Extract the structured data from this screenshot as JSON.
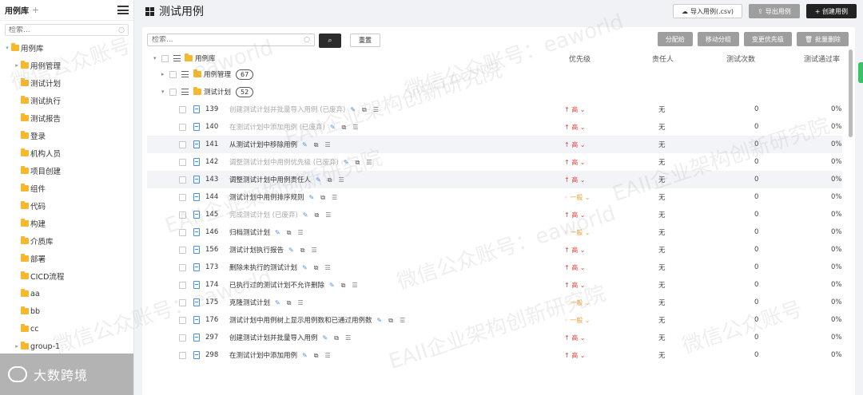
{
  "sidebar": {
    "title": "用例库",
    "plus": "+",
    "search_placeholder": "检索...",
    "items": [
      {
        "label": "用例库",
        "arrow": "▾"
      },
      {
        "label": "用例管理",
        "arrow": "▸"
      },
      {
        "label": "测试计划",
        "arrow": ""
      },
      {
        "label": "测试执行",
        "arrow": ""
      },
      {
        "label": "测试报告",
        "arrow": ""
      },
      {
        "label": "登录",
        "arrow": ""
      },
      {
        "label": "机构人员",
        "arrow": ""
      },
      {
        "label": "项目创建",
        "arrow": ""
      },
      {
        "label": "组件",
        "arrow": ""
      },
      {
        "label": "代码",
        "arrow": ""
      },
      {
        "label": "构建",
        "arrow": ""
      },
      {
        "label": "介质库",
        "arrow": ""
      },
      {
        "label": "部署",
        "arrow": ""
      },
      {
        "label": "CICD流程",
        "arrow": ""
      },
      {
        "label": "aa",
        "arrow": ""
      },
      {
        "label": "bb",
        "arrow": ""
      },
      {
        "label": "cc",
        "arrow": ""
      },
      {
        "label": "group-1",
        "arrow": "▸"
      }
    ],
    "footer_brand": "大数跨境"
  },
  "header": {
    "title": "测试用例",
    "import_label": "导入用例(.csv)",
    "export_label": "导出用例",
    "create_label": "+ 创建用例"
  },
  "toolbar": {
    "search_placeholder": "检索...",
    "reset_label": "重置",
    "assign_label": "分配给",
    "move_label": "移动分组",
    "priority_label": "变更优先级",
    "delete_label": "批量删除"
  },
  "table": {
    "columns": {
      "priority": "优先级",
      "owner": "责任人",
      "runs": "测试次数",
      "pass_rate": "测试通过率"
    },
    "root_label": "用例库",
    "groups": [
      {
        "label": "用例管理",
        "count": "67"
      },
      {
        "label": "测试计划",
        "count": "52"
      }
    ],
    "rows": [
      {
        "id": "139",
        "title": "创建测试计划并批量导入用例 (已废弃)",
        "priority": "高",
        "level": "high",
        "deprecated": true,
        "owner": "无",
        "runs": "0",
        "rate": "0%"
      },
      {
        "id": "140",
        "title": "在测试计划中添加用例 (已废弃)",
        "priority": "高",
        "level": "high",
        "deprecated": true,
        "owner": "无",
        "runs": "0",
        "rate": "0%"
      },
      {
        "id": "141",
        "title": "从测试计划中移除用例",
        "priority": "高",
        "level": "high",
        "deprecated": false,
        "owner": "无",
        "runs": "0",
        "rate": "0%"
      },
      {
        "id": "142",
        "title": "调整测试计划中用例优先级 (已废弃)",
        "priority": "高",
        "level": "high",
        "deprecated": true,
        "owner": "无",
        "runs": "0",
        "rate": "0%"
      },
      {
        "id": "143",
        "title": "调整测试计划中用例责任人",
        "priority": "高",
        "level": "high",
        "deprecated": false,
        "owner": "无",
        "runs": "0",
        "rate": "0%"
      },
      {
        "id": "144",
        "title": "测试计划中用例排序规则",
        "priority": "一般",
        "level": "mid",
        "deprecated": false,
        "owner": "无",
        "runs": "0",
        "rate": "0%"
      },
      {
        "id": "145",
        "title": "完成测试计划 (已废弃)",
        "priority": "高",
        "level": "high",
        "deprecated": true,
        "owner": "无",
        "runs": "0",
        "rate": "0%"
      },
      {
        "id": "146",
        "title": "归档测试计划",
        "priority": "一般",
        "level": "mid",
        "deprecated": false,
        "owner": "无",
        "runs": "0",
        "rate": "0%"
      },
      {
        "id": "156",
        "title": "测试计划执行报告",
        "priority": "高",
        "level": "high",
        "deprecated": false,
        "owner": "无",
        "runs": "0",
        "rate": "0%"
      },
      {
        "id": "173",
        "title": "删除未执行的测试计划",
        "priority": "高",
        "level": "high",
        "deprecated": false,
        "owner": "无",
        "runs": "0",
        "rate": "0%"
      },
      {
        "id": "174",
        "title": "已执行过的测试计划不允许删除",
        "priority": "高",
        "level": "high",
        "deprecated": false,
        "owner": "无",
        "runs": "0",
        "rate": "0%"
      },
      {
        "id": "175",
        "title": "克隆测试计划",
        "priority": "一般",
        "level": "mid",
        "deprecated": false,
        "owner": "无",
        "runs": "0",
        "rate": "0%"
      },
      {
        "id": "176",
        "title": "测试计划中用例树上显示用例数和已通过用例数",
        "priority": "一般",
        "level": "mid",
        "deprecated": false,
        "owner": "无",
        "runs": "0",
        "rate": "0%"
      },
      {
        "id": "297",
        "title": "创建测试计划并批量导入用例",
        "priority": "高",
        "level": "high",
        "deprecated": false,
        "owner": "无",
        "runs": "0",
        "rate": "0%"
      },
      {
        "id": "298",
        "title": "在测试计划中添加用例",
        "priority": "高",
        "level": "high",
        "deprecated": false,
        "owner": "无",
        "runs": "0",
        "rate": "0%"
      }
    ]
  },
  "colors": {
    "high": "#e0413c",
    "mid": "#e6a23c",
    "folder": "#f5b82e",
    "link": "#4a90e2"
  }
}
